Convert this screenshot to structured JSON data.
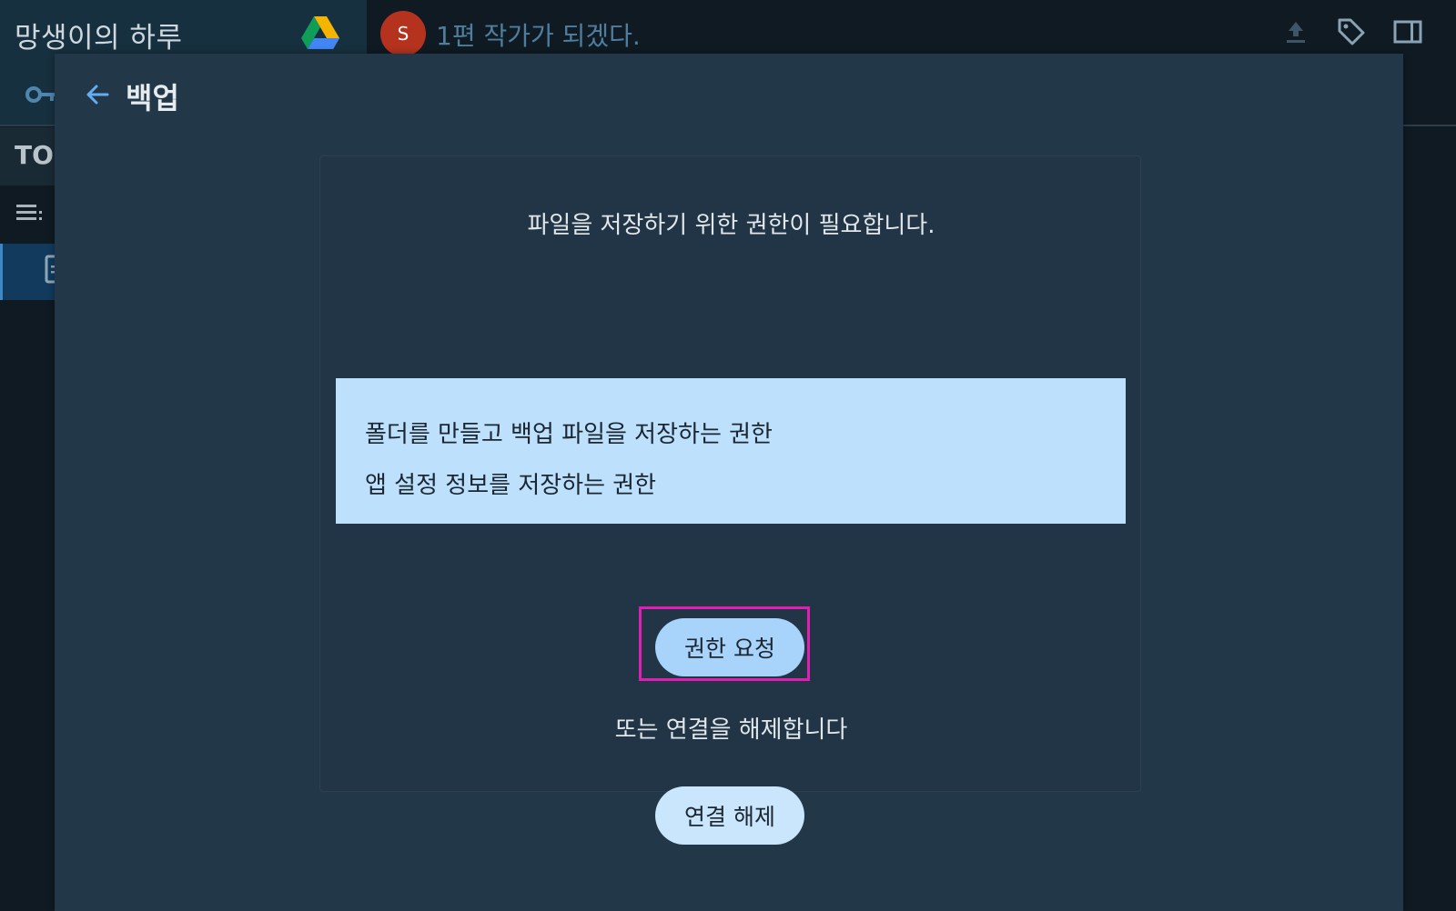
{
  "sidebar": {
    "book_title": "망생이의 하루",
    "toc_label": "TOC"
  },
  "topbar": {
    "avatar_letter": "S",
    "doc_title": "1편 작가가 되겠다."
  },
  "modal": {
    "title": "백업",
    "permission_message": "파일을 저장하기 위한 권한이 필요합니다.",
    "scopes": [
      "폴더를 만들고 백업 파일을 저장하는 권한",
      "앱 설정 정보를 저장하는 권한"
    ],
    "request_button": "권한 요청",
    "alternative_text": "또는 연결을 해제합니다",
    "disconnect_button": "연결 해제"
  },
  "colors": {
    "accent_blue": "#a8d3fb",
    "scope_bg": "#bde0fd",
    "highlight": "#e11eb4",
    "avatar": "#b5331e"
  }
}
